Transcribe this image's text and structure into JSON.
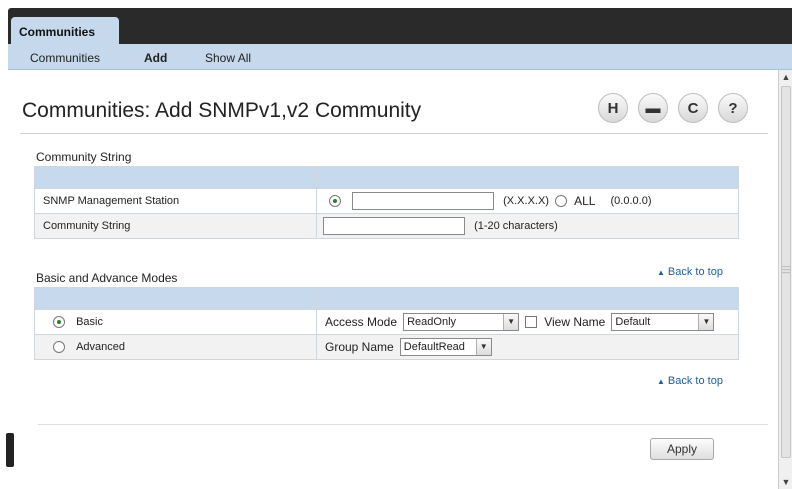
{
  "topbar": {
    "active_tab": "Communities"
  },
  "subnav": {
    "items": [
      "Communities",
      "Add",
      "Show All"
    ],
    "active": "Add"
  },
  "page": {
    "title": "Communities: Add SNMPv1,v2 Community"
  },
  "toolbar": {
    "icons": [
      "save-icon",
      "print-icon",
      "refresh-icon",
      "help-icon"
    ],
    "glyphs": [
      "H",
      "▬",
      "C",
      "?"
    ]
  },
  "community_string_section": {
    "label": "Community String",
    "rows": [
      {
        "label": "SNMP Management Station",
        "ip_value": "",
        "ip_hint": "(X.X.X.X)",
        "all_label": "ALL",
        "all_hint": "(0.0.0.0)"
      },
      {
        "label": "Community String",
        "value": "",
        "hint": "(1-20 characters)"
      }
    ]
  },
  "modes_section": {
    "label": "Basic and Advance Modes",
    "back_to_top": "Back to top",
    "basic": {
      "label": "Basic",
      "access_mode_label": "Access Mode",
      "access_mode_value": "ReadOnly",
      "view_name_label": "View Name",
      "view_name_value": "Default"
    },
    "advanced": {
      "label": "Advanced",
      "group_name_label": "Group Name",
      "group_name_value": "DefaultRead"
    }
  },
  "footer": {
    "back_to_top": "Back to top",
    "apply_label": "Apply"
  }
}
